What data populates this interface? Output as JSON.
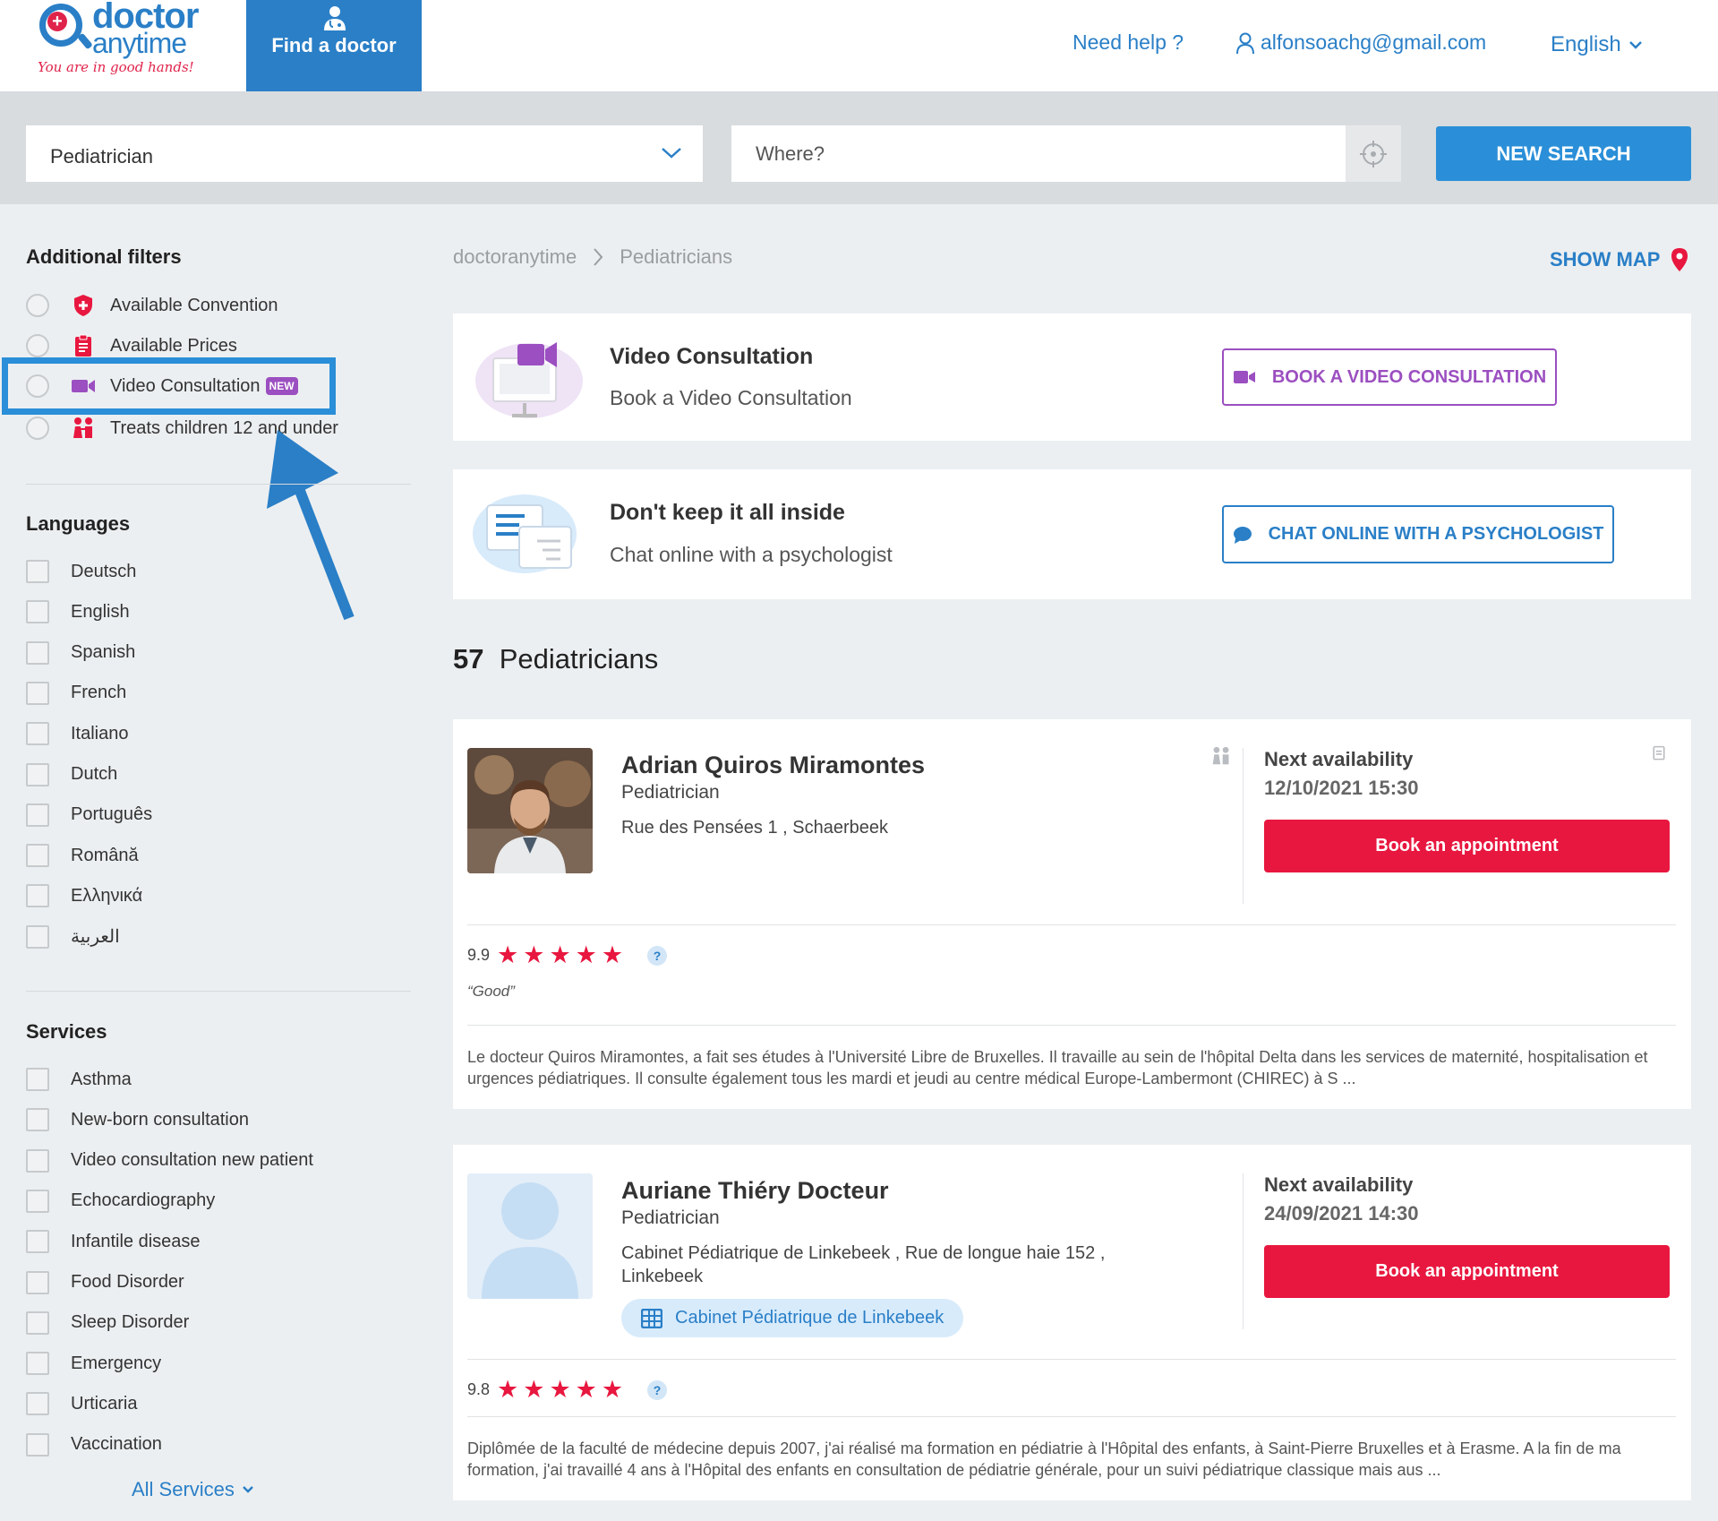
{
  "header": {
    "logo": {
      "brand_top": "doctor",
      "brand_bottom": "anytime",
      "tagline": "You are in good hands!"
    },
    "find_doctor": "Find a doctor",
    "need_help": "Need help ?",
    "user_email": "alfonsoachg@gmail.com",
    "language": "English",
    "colors": {
      "brand": "#2a7fc7",
      "accent": "#e8173f"
    }
  },
  "search": {
    "specialty_value": "Pediatrician",
    "where_placeholder": "Where?",
    "button": "NEW SEARCH"
  },
  "filters": {
    "heading": "Additional filters",
    "items": [
      {
        "label": "Available Convention",
        "icon": "shield-icon"
      },
      {
        "label": "Available Prices",
        "icon": "price-list-icon"
      },
      {
        "label": "Video Consultation",
        "icon": "video-camera-icon",
        "badge": "NEW"
      },
      {
        "label": "Treats children 12 and under",
        "icon": "children-icon"
      }
    ]
  },
  "languages": {
    "heading": "Languages",
    "items": [
      "Deutsch",
      "English",
      "Spanish",
      "French",
      "Italiano",
      "Dutch",
      "Português",
      "Română",
      "Ελληνικά",
      "العربية"
    ]
  },
  "services": {
    "heading": "Services",
    "items": [
      "Asthma",
      "New-born consultation",
      "Video consultation new patient",
      "Echocardiography",
      "Infantile disease",
      "Food Disorder",
      "Sleep Disorder",
      "Emergency",
      "Urticaria",
      "Vaccination"
    ],
    "all_link": "All Services"
  },
  "breadcrumb": [
    "doctoranytime",
    "Pediatricians"
  ],
  "show_map": "SHOW MAP",
  "promos": [
    {
      "title": "Video Consultation",
      "subtitle": "Book a Video Consultation",
      "button": "BOOK A VIDEO CONSULTATION",
      "color": "#9b4fc0"
    },
    {
      "title": "Don't keep it all inside",
      "subtitle": "Chat online with a psychologist",
      "button": "CHAT ONLINE WITH A PSYCHOLOGIST",
      "color": "#2a7fc7"
    }
  ],
  "results": {
    "count": "57",
    "label": "Pediatricians"
  },
  "doctors": [
    {
      "name": "Adrian Quiros Miramontes",
      "specialty": "Pediatrician",
      "address": "Rue des Pensées 1 , Schaerbeek",
      "availability_label": "Next availability",
      "availability_date": "12/10/2021 15:30",
      "book": "Book an appointment",
      "rating": "9.9",
      "stars": 5,
      "quote": "“Good”",
      "description": "Le docteur Quiros Miramontes, a fait ses études à l'Université Libre de Bruxelles. Il travaille au sein de l'hôpital Delta dans les services de maternité, hospitalisation et urgences pédiatriques. Il consulte également tous les mardi et jeudi au centre médical Europe-Lambermont (CHIREC) à S ..."
    },
    {
      "name": "Auriane Thiéry Docteur",
      "specialty": "Pediatrician",
      "address": "Cabinet Pédiatrique de Linkebeek , Rue de longue haie 152 , Linkebeek",
      "clinic": "Cabinet Pédiatrique de Linkebeek",
      "availability_label": "Next availability",
      "availability_date": "24/09/2021 14:30",
      "book": "Book an appointment",
      "rating": "9.8",
      "stars": 5,
      "description": "Diplômée de la faculté de médecine depuis 2007, j'ai réalisé ma formation en pédiatrie à l'Hôpital des enfants, à Saint-Pierre Bruxelles et à Erasme. A la fin de ma formation, j'ai travaillé 4 ans à l'Hôpital des enfants en consultation de pédiatrie générale, pour un suivi pédiatrique classique mais aus ..."
    }
  ]
}
